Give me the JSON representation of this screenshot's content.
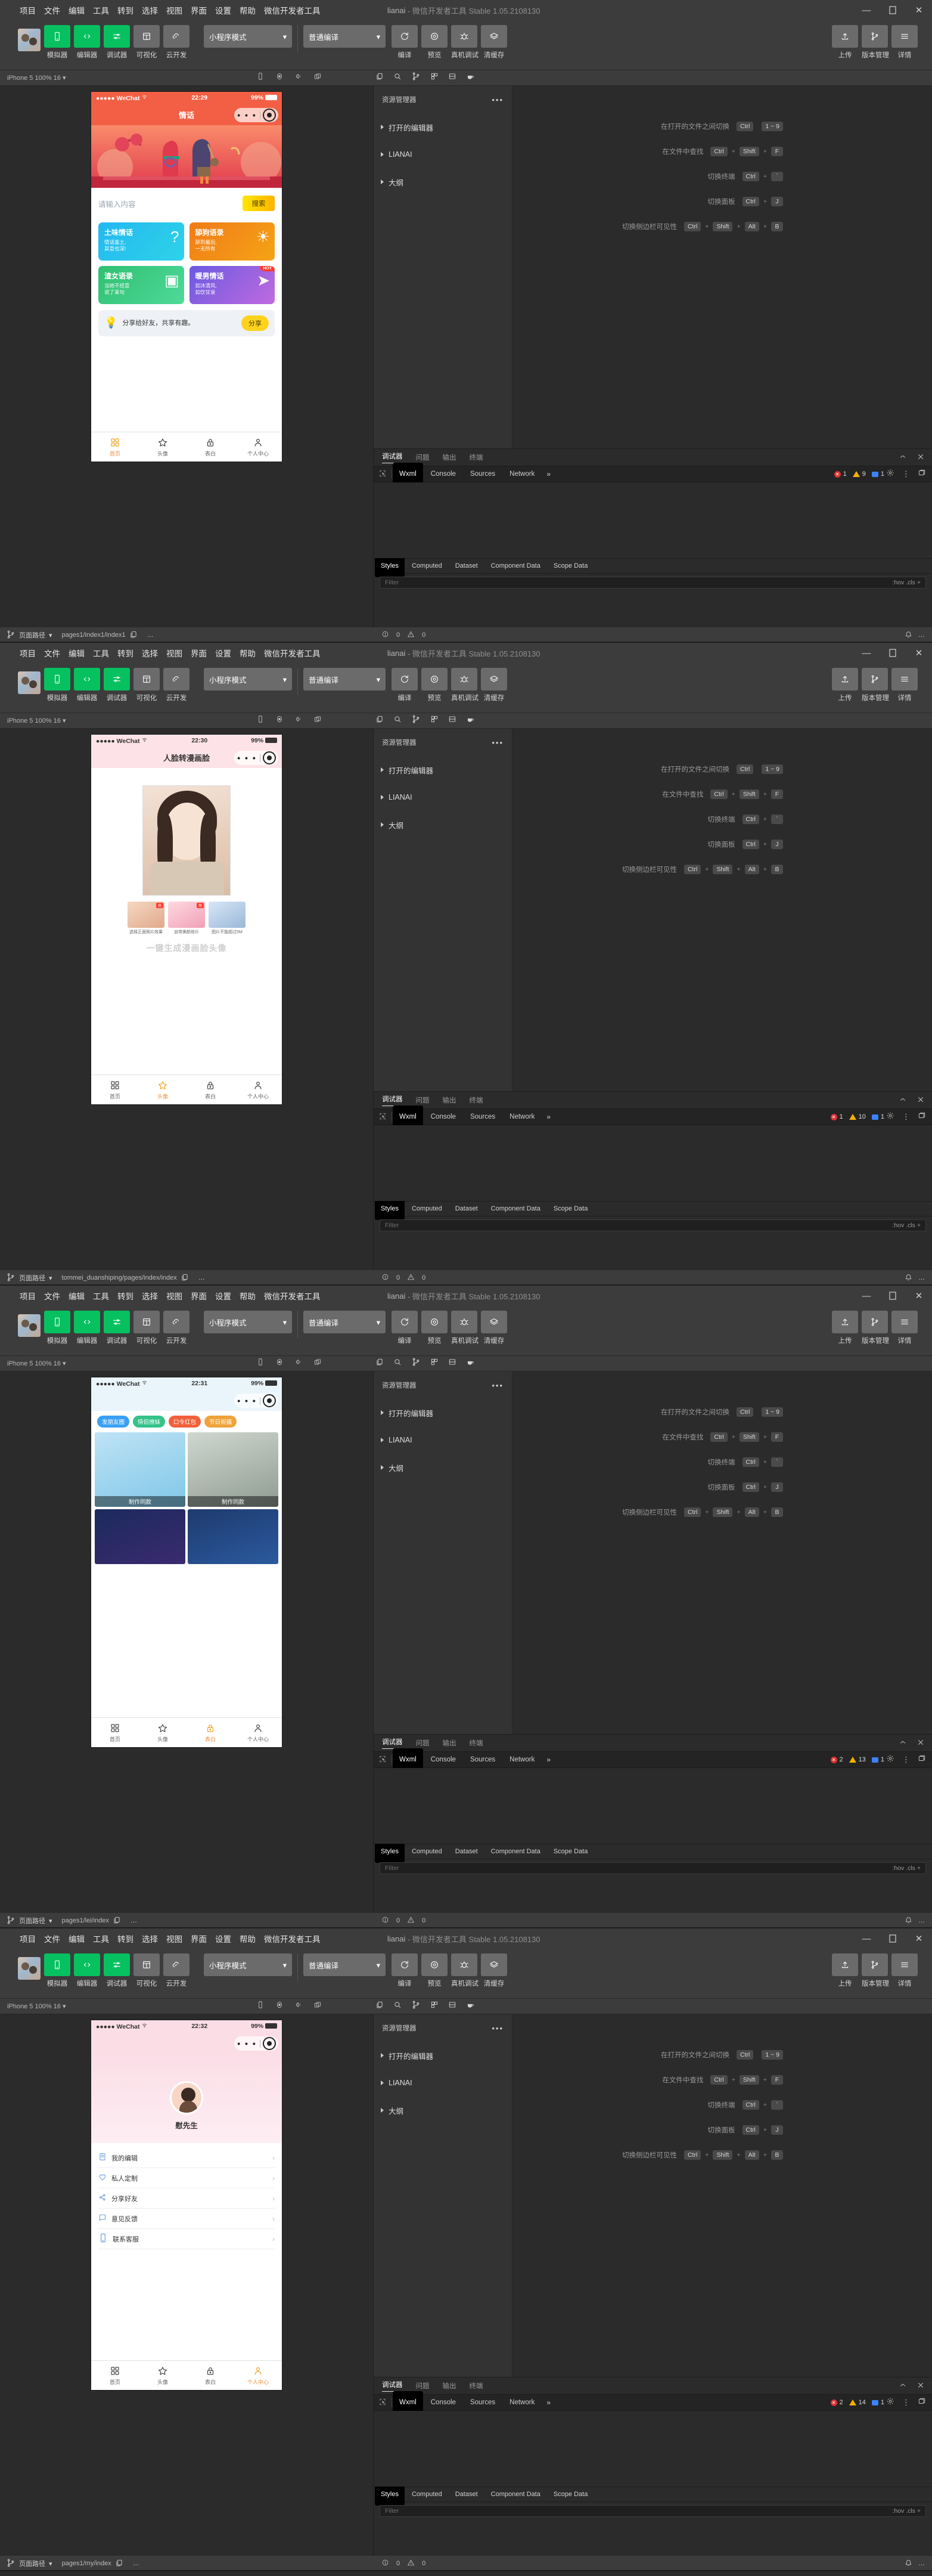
{
  "app": {
    "menu": [
      "项目",
      "文件",
      "编辑",
      "工具",
      "转到",
      "选择",
      "视图",
      "界面",
      "设置",
      "帮助",
      "微信开发者工具"
    ],
    "title_project": "lianai",
    "title_rest": "- 微信开发者工具 Stable 1.05.2108130",
    "window_buttons": [
      "minimize-icon",
      "maximize-icon",
      "close-icon"
    ]
  },
  "toolbar": {
    "buttons": [
      {
        "label": "模拟器",
        "icon": "phone-icon",
        "style": "green"
      },
      {
        "label": "编辑器",
        "icon": "code-icon",
        "style": "green"
      },
      {
        "label": "调试器",
        "icon": "debugger-icon",
        "style": "green"
      },
      {
        "label": "可视化",
        "icon": "layout-icon",
        "style": "grey"
      },
      {
        "label": "云开发",
        "icon": "cloud-icon",
        "style": "grey"
      }
    ],
    "mode_select": "小程序模式",
    "compile_select": "普通编译",
    "actions": [
      {
        "label": "编译",
        "icon": "refresh-icon"
      },
      {
        "label": "预览",
        "icon": "preview-icon"
      },
      {
        "label": "真机调试",
        "icon": "bug-icon"
      },
      {
        "label": "清缓存",
        "icon": "layers-icon"
      }
    ],
    "right_actions": [
      {
        "label": "上传",
        "icon": "upload-icon"
      },
      {
        "label": "版本管理",
        "icon": "branch-icon"
      },
      {
        "label": "详情",
        "icon": "menu-icon"
      }
    ]
  },
  "simbar": {
    "device": "iPhone 5 100% 16",
    "icons_left": [
      "device-icon",
      "home-button-icon",
      "volume-icon",
      "rotate-icon"
    ],
    "icons_right": [
      "copy-icon",
      "search-icon",
      "branch-icon",
      "grid-icon",
      "split-icon",
      "coffee-icon"
    ]
  },
  "explorer": {
    "title": "资源管理器",
    "menu_icon": "ellipsis-icon",
    "items": [
      "打开的编辑器",
      "LIANAI",
      "大纲"
    ]
  },
  "shortcuts": [
    {
      "label": "在打开的文件之间切换",
      "keys": [
        "Ctrl",
        "1 ~ 9"
      ],
      "joiners": [
        ""
      ]
    },
    {
      "label": "在文件中查找",
      "keys": [
        "Ctrl",
        "Shift",
        "F"
      ],
      "joiners": [
        "+",
        "+"
      ]
    },
    {
      "label": "切换终端",
      "keys": [
        "Ctrl",
        "`"
      ],
      "joiners": [
        "+"
      ]
    },
    {
      "label": "切换面板",
      "keys": [
        "Ctrl",
        "J"
      ],
      "joiners": [
        "+"
      ]
    },
    {
      "label": "切换侧边栏可见性",
      "keys": [
        "Ctrl",
        "Shift",
        "Alt",
        "B"
      ],
      "joiners": [
        "+",
        "+",
        "+"
      ]
    }
  ],
  "devtools": {
    "panels": [
      "调试器",
      "问题",
      "输出",
      "终端"
    ],
    "panel_active": "调试器",
    "collapse_icon": "chevron-up-icon",
    "close_icon": "close-icon",
    "inspect_icon": "inspect-icon",
    "tabs": [
      "Wxml",
      "Console",
      "Sources",
      "Network"
    ],
    "tab_active": "Wxml",
    "more": "»",
    "settings_icon": "gear-icon",
    "kebab_icon": "kebab-icon",
    "dock_icon": "dock-icon",
    "style_tabs": [
      "Styles",
      "Computed",
      "Dataset",
      "Component Data",
      "Scope Data"
    ],
    "style_tab_active": "Styles",
    "filter_placeholder": "Filter",
    "filter_right": ":hov .cls +"
  },
  "statusbar": {
    "branch": "页面路径",
    "branch_icon": "branch-icon",
    "copy_icon": "copy-icon",
    "problems_icon": "error-icon",
    "problems": "0",
    "warn_icon": "warning-icon",
    "warns": "0",
    "bell_icon": "bell-icon",
    "ellipsis": "…"
  },
  "windows": [
    {
      "id": "window-1",
      "counts": {
        "errors": "1",
        "warnings": "9",
        "messages": "1"
      },
      "status_path": "pages1/index1/index1",
      "phone": {
        "carrier": "●●●●● WeChat",
        "wifi_icon": "wifi-icon",
        "time": "22:29",
        "battery_pct": "99%",
        "battery_icon": "battery-icon",
        "nav_title": "情话",
        "capsule": {
          "dots": "• • •",
          "target_icon": "target-icon"
        },
        "search_placeholder": "请输入内容",
        "search_button": "搜索",
        "cards": [
          {
            "title": "土味情话",
            "sub1": "情话虽土,",
            "sub2": "其意也深!",
            "glyph": "?",
            "bg": "linear-gradient(135deg,#23b8f0,#2ed3e8)",
            "hot": false
          },
          {
            "title": "舔狗语录",
            "sub1": "舔到最后,",
            "sub2": "一无所有",
            "glyph": "☀",
            "bg": "linear-gradient(135deg,#f07c18,#f5a316)",
            "hot": false
          },
          {
            "title": "渣女语录",
            "sub1": "当她不经意",
            "sub2": "说了某句",
            "glyph": "▣",
            "bg": "linear-gradient(135deg,#2fc070,#4fd99a)",
            "hot": false
          },
          {
            "title": "暖男情话",
            "sub1": "如沐清风,",
            "sub2": "如饮甘泉",
            "glyph": "➤",
            "bg": "linear-gradient(135deg,#6a5ae0,#c06ae0)",
            "hot": true,
            "hot_label": "HOT"
          }
        ],
        "share": {
          "icon": "bulb-icon",
          "text": "分享给好友，共享有趣。",
          "button": "分享"
        },
        "tabs": [
          {
            "label": "首页",
            "icon": "grid-icon",
            "active": true
          },
          {
            "label": "头像",
            "icon": "star-icon",
            "active": false
          },
          {
            "label": "表白",
            "icon": "lock-icon",
            "active": false
          },
          {
            "label": "个人中心",
            "icon": "person-icon",
            "active": false
          }
        ]
      }
    },
    {
      "id": "window-2",
      "counts": {
        "errors": "1",
        "warnings": "10",
        "messages": "1"
      },
      "status_path": "tommei_duanshiping/pages/index/index",
      "phone": {
        "carrier": "●●●●● WeChat",
        "wifi_icon": "wifi-icon",
        "time": "22:30",
        "battery_pct": "99%",
        "battery_icon": "battery-icon",
        "nav_title": "人脸转漫画脸",
        "capsule": {
          "dots": "• • •",
          "target_icon": "target-icon"
        },
        "big_title": "一键生成漫画脸头像",
        "thumbs": [
          {
            "caption": "选择正面照片效果",
            "tag": "热"
          },
          {
            "caption": "自带美颜修片",
            "tag": "荐"
          },
          {
            "caption": "图片不能超过5M",
            "tag": ""
          }
        ],
        "tabs": [
          {
            "label": "首页",
            "icon": "grid-icon",
            "active": false
          },
          {
            "label": "头像",
            "icon": "star-icon",
            "active": true
          },
          {
            "label": "表白",
            "icon": "lock-icon",
            "active": false
          },
          {
            "label": "个人中心",
            "icon": "person-icon",
            "active": false
          }
        ]
      }
    },
    {
      "id": "window-3",
      "counts": {
        "errors": "2",
        "warnings": "13",
        "messages": "1"
      },
      "status_path": "pages1/lei/index",
      "phone": {
        "carrier": "●●●●● WeChat",
        "wifi_icon": "wifi-icon",
        "time": "22:31",
        "battery_pct": "99%",
        "battery_icon": "battery-icon",
        "nav_title": "",
        "capsule": {
          "dots": "• • •",
          "target_icon": "target-icon"
        },
        "chips": [
          {
            "label": "发朋友圈",
            "bg": "#3aa0f5"
          },
          {
            "label": "情侣撩妹",
            "bg": "#33c28a"
          },
          {
            "label": "口令红包",
            "bg": "#f0603a"
          },
          {
            "label": "节日祝福",
            "bg": "#f0a33a"
          }
        ],
        "cells": [
          {
            "caption": "制作同款",
            "bg": "linear-gradient(160deg,#bfe3f5,#7fc7e8)"
          },
          {
            "caption": "制作同款",
            "bg": "linear-gradient(160deg,#cfd8d0,#8f9b92)"
          }
        ],
        "cells2": [
          {
            "bg": "linear-gradient(160deg,#1b2a5e,#3b2a6e)"
          },
          {
            "bg": "linear-gradient(160deg,#1f3a6e,#2a5a9e)"
          }
        ],
        "tabs": [
          {
            "label": "首页",
            "icon": "grid-icon",
            "active": false
          },
          {
            "label": "头像",
            "icon": "star-icon",
            "active": false
          },
          {
            "label": "表白",
            "icon": "lock-icon",
            "active": true
          },
          {
            "label": "个人中心",
            "icon": "person-icon",
            "active": false
          }
        ]
      }
    },
    {
      "id": "window-4",
      "counts": {
        "errors": "2",
        "warnings": "14",
        "messages": "1"
      },
      "status_path": "pages1/my/index",
      "phone": {
        "carrier": "●●●●● WeChat",
        "wifi_icon": "wifi-icon",
        "time": "22:32",
        "battery_pct": "99%",
        "battery_icon": "battery-icon",
        "nav_title": "",
        "capsule": {
          "dots": "• • •",
          "target_icon": "target-icon"
        },
        "profile_name": "慰先生",
        "menu_rows": [
          {
            "label": "我的编辑",
            "icon": "doc-icon"
          },
          {
            "label": "私人定制",
            "icon": "heart-icon"
          },
          {
            "label": "分享好友",
            "icon": "share-icon"
          },
          {
            "label": "意见反馈",
            "icon": "chat-icon"
          },
          {
            "label": "联系客服",
            "icon": "phone-icon"
          }
        ],
        "tabs": [
          {
            "label": "首页",
            "icon": "grid-icon",
            "active": false
          },
          {
            "label": "头像",
            "icon": "star-icon",
            "active": false
          },
          {
            "label": "表白",
            "icon": "lock-icon",
            "active": false
          },
          {
            "label": "个人中心",
            "icon": "person-icon",
            "active": true
          }
        ]
      }
    }
  ]
}
